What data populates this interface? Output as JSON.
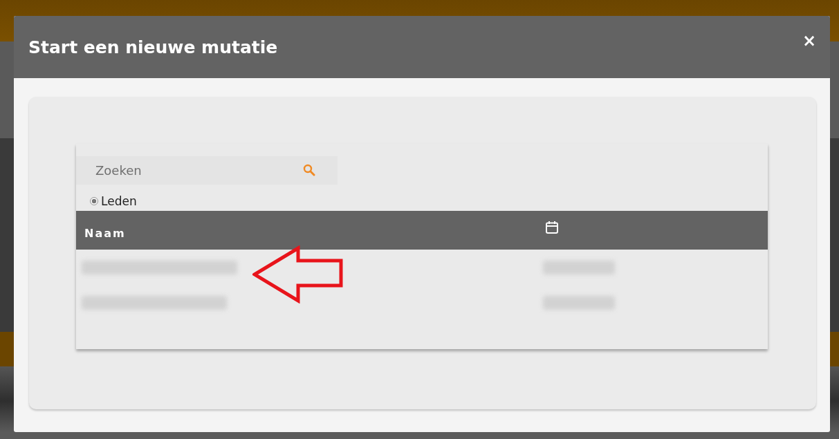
{
  "dialog": {
    "title": "Start een nieuwe mutatie",
    "close": "×"
  },
  "search": {
    "placeholder": "Zoeken"
  },
  "filters": [
    {
      "label": "Leden",
      "selected": true
    }
  ],
  "table": {
    "columns": [
      {
        "kind": "text",
        "label": "Naam"
      },
      {
        "kind": "calendar-icon"
      }
    ],
    "rows": [
      {
        "cells": [
          {
            "kind": "redacted"
          },
          {
            "kind": "redacted"
          }
        ]
      },
      {
        "cells": [
          {
            "kind": "redacted"
          },
          {
            "kind": "redacted"
          }
        ]
      }
    ]
  }
}
